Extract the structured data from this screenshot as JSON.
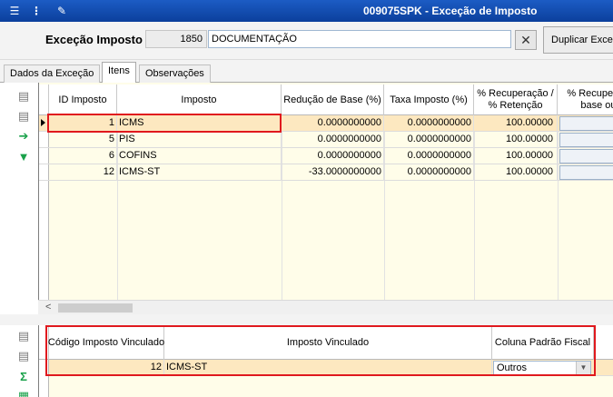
{
  "titlebar": {
    "title": "009075SPK - Exceção de Imposto",
    "icons": [
      "menu-icon",
      "traffic-light-icon",
      "wrench-icon"
    ]
  },
  "header": {
    "label": "Exceção Imposto",
    "code": "1850",
    "description": "DOCUMENTAÇÃO",
    "clear_label": "✕",
    "duplicate_label": "Duplicar Exceção"
  },
  "tabs": [
    "Dados da Exceção",
    "Itens",
    "Observações"
  ],
  "active_tab": "Itens",
  "grid1": {
    "columns": [
      "ID Imposto",
      "Imposto",
      "Redução de Base (%)",
      "Taxa Imposto (%)",
      "% Recuperação / % Retenção",
      "% Recuperação base ou a"
    ],
    "rows": [
      {
        "id": "1",
        "imposto": "ICMS",
        "reducao": "0.0000000000",
        "taxa": "0.0000000000",
        "recuperacao": "100.00000"
      },
      {
        "id": "5",
        "imposto": "PIS",
        "reducao": "0.0000000000",
        "taxa": "0.0000000000",
        "recuperacao": "100.00000"
      },
      {
        "id": "6",
        "imposto": "COFINS",
        "reducao": "0.0000000000",
        "taxa": "0.0000000000",
        "recuperacao": "100.00000"
      },
      {
        "id": "12",
        "imposto": "ICMS-ST",
        "reducao": "-33.0000000000",
        "taxa": "0.0000000000",
        "recuperacao": "100.00000"
      }
    ],
    "scroll_left_arrow": "<"
  },
  "grid2": {
    "columns": [
      "Código Imposto Vinculado",
      "Imposto Vinculado",
      "Coluna Padrão Fiscal"
    ],
    "rows": [
      {
        "codigo": "12",
        "imposto": "ICMS-ST",
        "coluna": "Outros"
      }
    ]
  },
  "colors": {
    "titlebar": "#0b3f9c",
    "selected_row": "#fde8c0",
    "grid_bg": "#fffde9",
    "highlight": "#e0191e",
    "green_icon": "#19a14a"
  }
}
